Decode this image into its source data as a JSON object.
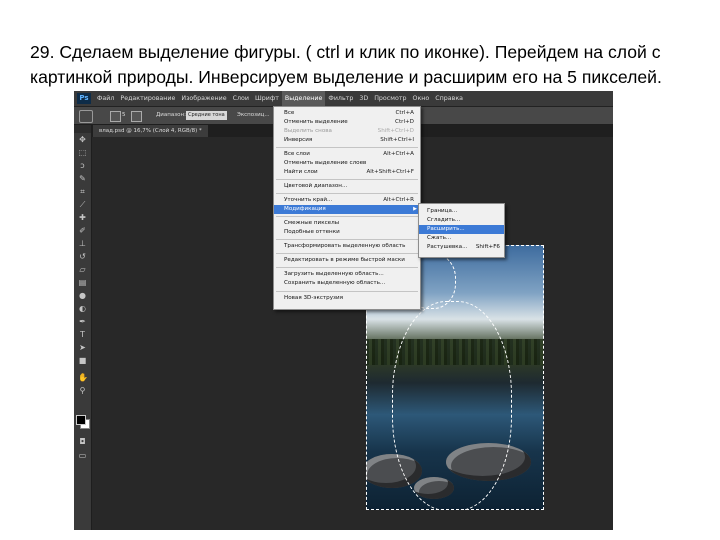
{
  "caption": "29.  Сделаем выделение фигуры. ( ctrl и клик по иконке). Перейдем на слой с картинкой природы. Инверсируем выделение  и расширим его на 5 пикселей.",
  "app": {
    "logo": "Ps",
    "menu": [
      "Файл",
      "Редактирование",
      "Изображение",
      "Слои",
      "Шрифт",
      "Выделение",
      "Фильтр",
      "3D",
      "Просмотр",
      "Окно",
      "Справка"
    ],
    "active_menu": "Выделение"
  },
  "options_bar": {
    "size_value": "5",
    "mode_label": "Диапазон:",
    "mode_value": "Средние тона",
    "exposure_label": "Экспозиц...",
    "icons": [
      "brush-tool-icon",
      "airbrush-icon",
      "settings-icon"
    ]
  },
  "document_tab": "влад.psd @ 16,7% (Слой 4, RGB/8) *",
  "tools": [
    "move-tool-icon",
    "marquee-tool-icon",
    "lasso-tool-icon",
    "quick-select-icon",
    "crop-tool-icon",
    "eyedropper-icon",
    "healing-brush-icon",
    "brush-icon",
    "clone-stamp-icon",
    "history-brush-icon",
    "eraser-icon",
    "gradient-icon",
    "blur-icon",
    "dodge-icon",
    "pen-icon",
    "type-icon",
    "path-select-icon",
    "shape-icon",
    "hand-icon",
    "zoom-icon"
  ],
  "selection_menu": [
    {
      "label": "Все",
      "shortcut": "Ctrl+A"
    },
    {
      "label": "Отменить выделение",
      "shortcut": "Ctrl+D"
    },
    {
      "label": "Выделить снова",
      "shortcut": "Shift+Ctrl+D",
      "disabled": true
    },
    {
      "label": "Инверсия",
      "shortcut": "Shift+Ctrl+I"
    },
    {
      "label": "Все слои",
      "shortcut": "Alt+Ctrl+A"
    },
    {
      "label": "Отменить выделение слоев",
      "shortcut": ""
    },
    {
      "label": "Найти слои",
      "shortcut": "Alt+Shift+Ctrl+F"
    },
    {
      "label": "Цветовой диапазон...",
      "shortcut": ""
    },
    {
      "label": "Уточнить край...",
      "shortcut": "Alt+Ctrl+R"
    },
    {
      "label": "Модификация",
      "shortcut": "",
      "submenu": true,
      "highlighted": true
    },
    {
      "label": "Смежные пикселы",
      "shortcut": ""
    },
    {
      "label": "Подобные оттенки",
      "shortcut": ""
    },
    {
      "label": "Трансформировать выделенную область",
      "shortcut": ""
    },
    {
      "label": "Редактировать в режиме быстрой маски",
      "shortcut": ""
    },
    {
      "label": "Загрузить выделенную область...",
      "shortcut": ""
    },
    {
      "label": "Сохранить выделенную область...",
      "shortcut": ""
    },
    {
      "label": "Новая 3D-экструзия",
      "shortcut": ""
    }
  ],
  "modify_submenu": [
    {
      "label": "Граница...",
      "shortcut": ""
    },
    {
      "label": "Сгладить...",
      "shortcut": ""
    },
    {
      "label": "Расширить...",
      "shortcut": "",
      "highlighted": true
    },
    {
      "label": "Сжать...",
      "shortcut": ""
    },
    {
      "label": "Растушевка...",
      "shortcut": "Shift+F6"
    }
  ],
  "colors": {
    "menu_highlight": "#3c7ad6",
    "workspace": "#282828",
    "foreground": "#000000",
    "background": "#ffffff"
  }
}
